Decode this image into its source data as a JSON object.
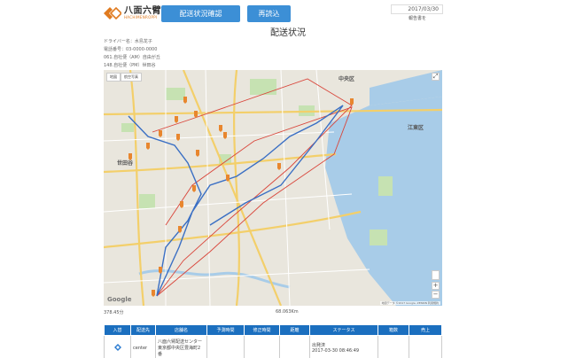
{
  "header": {
    "logo_text": "八面六臂",
    "logo_subtext": "HACHIMENROPPI",
    "status_button": "配送状況確認",
    "reload_button": "再読込",
    "date": "2017/03/30",
    "report_link": "報告書を"
  },
  "page_title": "配送状況",
  "info": {
    "driver": "ドライバー名：水島龙子",
    "phone": "電話番号：03-0000-0000",
    "am_area": "061.自社便（AM）自由が丘",
    "pm_area": "148.自社便（PM）世田谷"
  },
  "map": {
    "tab_map": "地図",
    "tab_satellite": "航空写真",
    "wards": [
      "中央区",
      "江東区",
      "世田谷"
    ],
    "google_label": "Google",
    "attribution": "地図データ ©2017 Google, ZENRIN 利用規約",
    "zoom_in": "+",
    "zoom_out": "−",
    "fullscreen": "⤢"
  },
  "stats": {
    "duration": "378.45分",
    "distance": "68.063Km"
  },
  "table": {
    "headers": [
      "入替",
      "配送先",
      "店舗名",
      "予測時間",
      "修正時間",
      "距離",
      "ステータス",
      "箱数",
      "売上"
    ],
    "rows": [
      {
        "type": "center",
        "shop": "八面六臂配送センター 東京都中央区豊海町2番",
        "predicted": "",
        "corrected": "",
        "distance": "",
        "status": "出発済",
        "status_time": "2017-03-30 08:46:49",
        "boxes": "",
        "sales": ""
      }
    ]
  },
  "colors": {
    "accent": "#3c8fd6",
    "table_header": "#1b6fbf",
    "route_red": "#d9453a",
    "route_blue": "#3a6fc4",
    "marker": "#e8862e"
  }
}
